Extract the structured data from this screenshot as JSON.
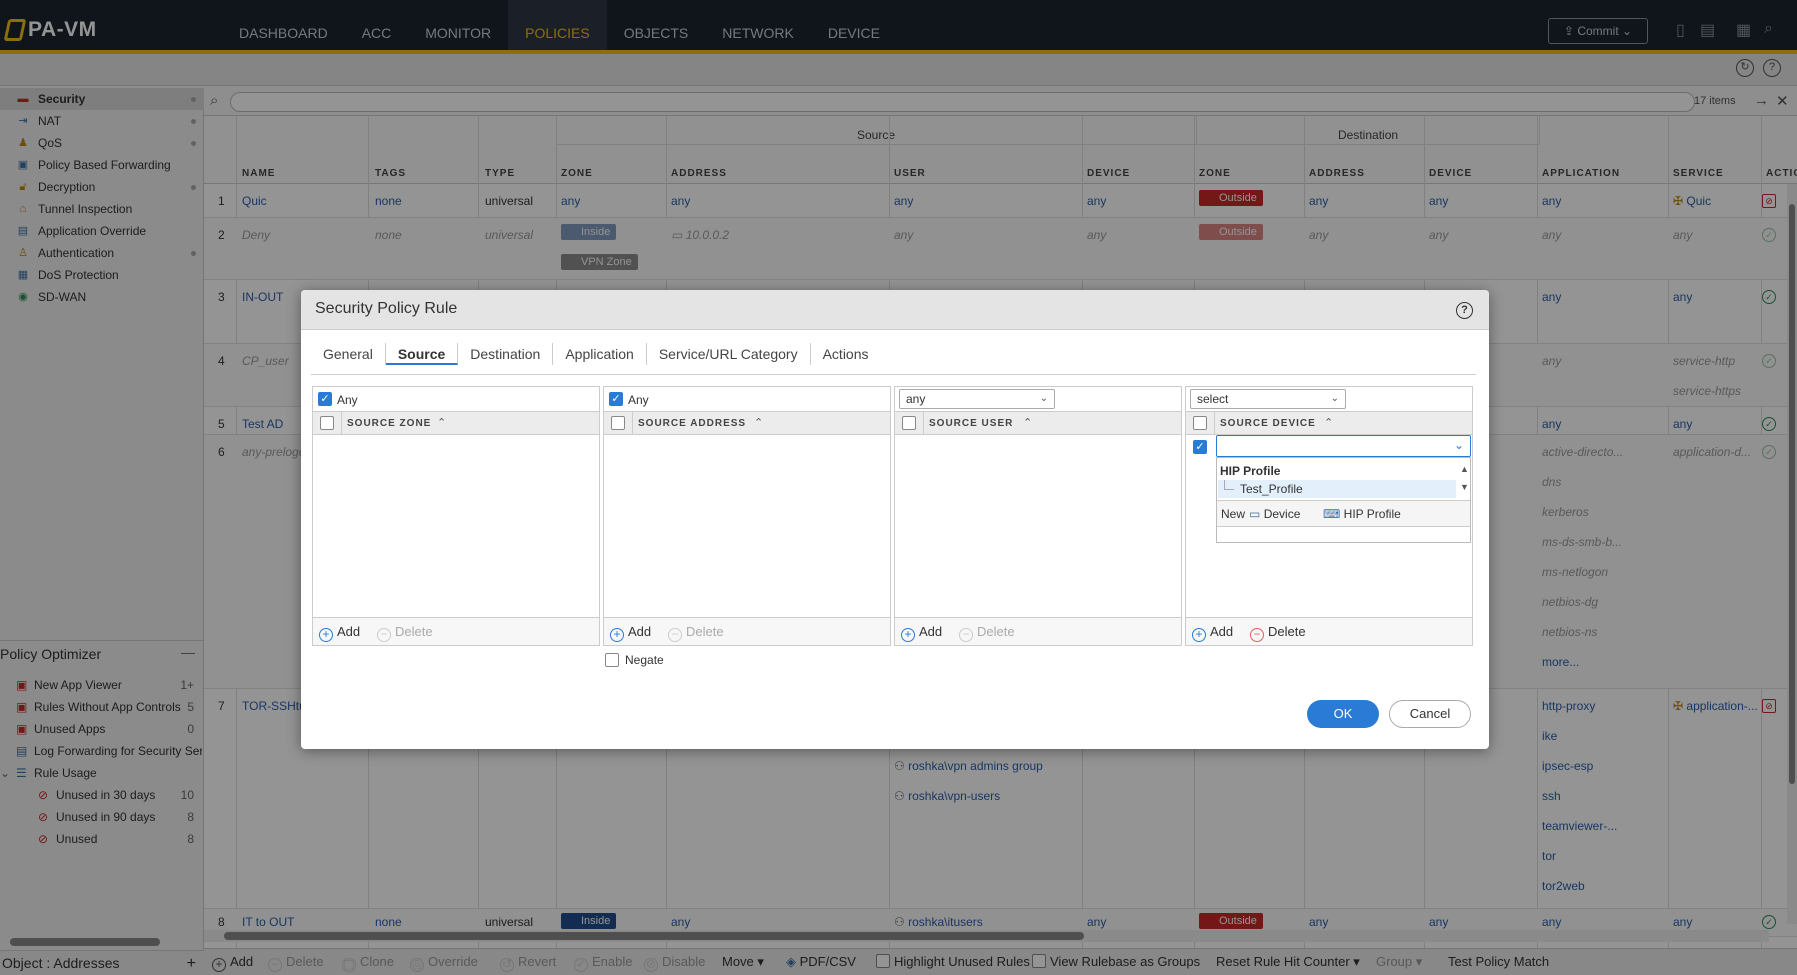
{
  "app": {
    "title": "PA-VM"
  },
  "nav": [
    "DASHBOARD",
    "ACC",
    "MONITOR",
    "POLICIES",
    "OBJECTS",
    "NETWORK",
    "DEVICE"
  ],
  "nav_active": "POLICIES",
  "toolbar": {
    "commit_label": "Commit"
  },
  "sidebar": {
    "items": [
      {
        "label": "Security",
        "icon": "security-icon"
      },
      {
        "label": "NAT",
        "icon": "nat-icon"
      },
      {
        "label": "QoS",
        "icon": "qos-icon"
      },
      {
        "label": "Policy Based Forwarding",
        "icon": "pbf-icon"
      },
      {
        "label": "Decryption",
        "icon": "decryption-icon"
      },
      {
        "label": "Tunnel Inspection",
        "icon": "tunnel-icon"
      },
      {
        "label": "Application Override",
        "icon": "app-override-icon"
      },
      {
        "label": "Authentication",
        "icon": "authentication-icon"
      },
      {
        "label": "DoS Protection",
        "icon": "dos-icon"
      },
      {
        "label": "SD-WAN",
        "icon": "sdwan-icon"
      }
    ],
    "optimizer_title": "Policy Optimizer",
    "optimizer_items": [
      {
        "label": "New App Viewer",
        "count": "1+"
      },
      {
        "label": "Rules Without App Controls",
        "count": "5"
      },
      {
        "label": "Unused Apps",
        "count": "0"
      },
      {
        "label": "Log Forwarding for Security Ser",
        "count": ""
      },
      {
        "label": "Rule Usage",
        "count": ""
      },
      {
        "label": "Unused in 30 days",
        "count": "10"
      },
      {
        "label": "Unused in 90 days",
        "count": "8"
      },
      {
        "label": "Unused",
        "count": "8"
      }
    ],
    "footer": "Object : Addresses"
  },
  "grid": {
    "items_count": "17 items",
    "group_source": "Source",
    "group_destination": "Destination",
    "columns": [
      "NAME",
      "TAGS",
      "TYPE",
      "ZONE",
      "ADDRESS",
      "USER",
      "DEVICE",
      "ZONE",
      "ADDRESS",
      "DEVICE",
      "APPLICATION",
      "SERVICE",
      "ACTIO"
    ],
    "rows": [
      {
        "num": "1",
        "name": "Quic",
        "tags": "none",
        "type": "universal",
        "src_zone": "any",
        "src_addr": "any",
        "user": "any",
        "device": "any",
        "dst_zone": "Outside",
        "dst_addr": "any",
        "dst_device": "any",
        "app": "any",
        "service": "Quic"
      },
      {
        "num": "2",
        "name": "Deny",
        "tags": "none",
        "type": "universal",
        "src_zone": "Inside",
        "src_zone2": "VPN Zone",
        "src_addr": "10.0.0.2",
        "user": "any",
        "device": "any",
        "dst_zone": "Outside",
        "dst_addr": "any",
        "dst_device": "any",
        "app": "any",
        "service": "any"
      },
      {
        "num": "3",
        "name": "IN-OUT",
        "app": "any",
        "service": "any"
      },
      {
        "num": "4",
        "name": "CP_user",
        "app": "any",
        "service": "service-http",
        "service2": "service-https"
      },
      {
        "num": "5",
        "name": "Test AD",
        "app": "any",
        "service": "any"
      },
      {
        "num": "6",
        "name": "any-prelogo",
        "apps": [
          "active-directo...",
          "dns",
          "kerberos",
          "ms-ds-smb-b...",
          "ms-netlogon",
          "netbios-dg",
          "netbios-ns"
        ],
        "more": "more...",
        "service": "application-d..."
      },
      {
        "num": "7",
        "name": "TOR-SSHtu",
        "users": [
          "roshka\\vpn admins group",
          "roshka\\vpn-users"
        ],
        "apps": [
          "http-proxy",
          "ike",
          "ipsec-esp",
          "ssh",
          "teamviewer-...",
          "tor",
          "tor2web"
        ],
        "service": "application-..."
      },
      {
        "num": "8",
        "name": "IT to OUT",
        "tags": "none",
        "type": "universal",
        "src_zone": "Inside",
        "src_addr": "any",
        "user": "roshka\\itusers",
        "device": "any",
        "dst_zone": "Outside",
        "dst_addr": "any",
        "dst_device": "any",
        "app": "any",
        "service": "any"
      }
    ]
  },
  "bottombar": {
    "add": "Add",
    "delete": "Delete",
    "clone": "Clone",
    "override": "Override",
    "revert": "Revert",
    "enable": "Enable",
    "disable": "Disable",
    "move": "Move",
    "pdf": "PDF/CSV",
    "highlight": "Highlight Unused Rules",
    "view_groups": "View Rulebase as Groups",
    "reset_counter": "Reset Rule Hit Counter",
    "group": "Group",
    "test_match": "Test Policy Match"
  },
  "dialog": {
    "title": "Security Policy Rule",
    "tabs": [
      "General",
      "Source",
      "Destination",
      "Application",
      "Service/URL Category",
      "Actions"
    ],
    "active_tab": "Source",
    "zone_any": "Any",
    "zone_header": "SOURCE ZONE",
    "address_any": "Any",
    "address_header": "SOURCE ADDRESS",
    "user_select": "any",
    "user_header": "SOURCE USER",
    "device_select": "select",
    "device_header": "SOURCE DEVICE",
    "dropdown_group": "HIP Profile",
    "dropdown_item": "Test_Profile",
    "dropdown_new": "New",
    "dropdown_new_device": "Device",
    "dropdown_new_hip": "HIP Profile",
    "add": "Add",
    "delete": "Delete",
    "negate": "Negate",
    "ok": "OK",
    "cancel": "Cancel"
  }
}
